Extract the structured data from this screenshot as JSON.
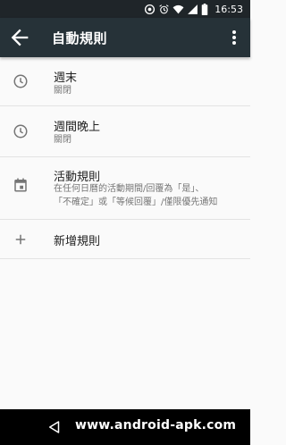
{
  "status_bar": {
    "time": "16:53"
  },
  "toolbar": {
    "title": "自動規則"
  },
  "rules": [
    {
      "title": "週末",
      "subtitle": "關閉",
      "icon": "clock-icon"
    },
    {
      "title": "週間晚上",
      "subtitle": "關閉",
      "icon": "clock-icon"
    },
    {
      "title": "活動規則",
      "subtitle_lines": [
        "在任何日曆的活動期間/回覆為「是」、",
        "「不確定」或「等候回覆」/僅限優先通知"
      ],
      "icon": "calendar-icon"
    }
  ],
  "add_rule": {
    "label": "新增規則",
    "icon": "plus-icon"
  },
  "watermark": "www.android-apk.com",
  "colors": {
    "toolbar": "#263238",
    "status_bar": "#1f2529",
    "background": "#fafafa",
    "icon_gray": "#757575"
  }
}
